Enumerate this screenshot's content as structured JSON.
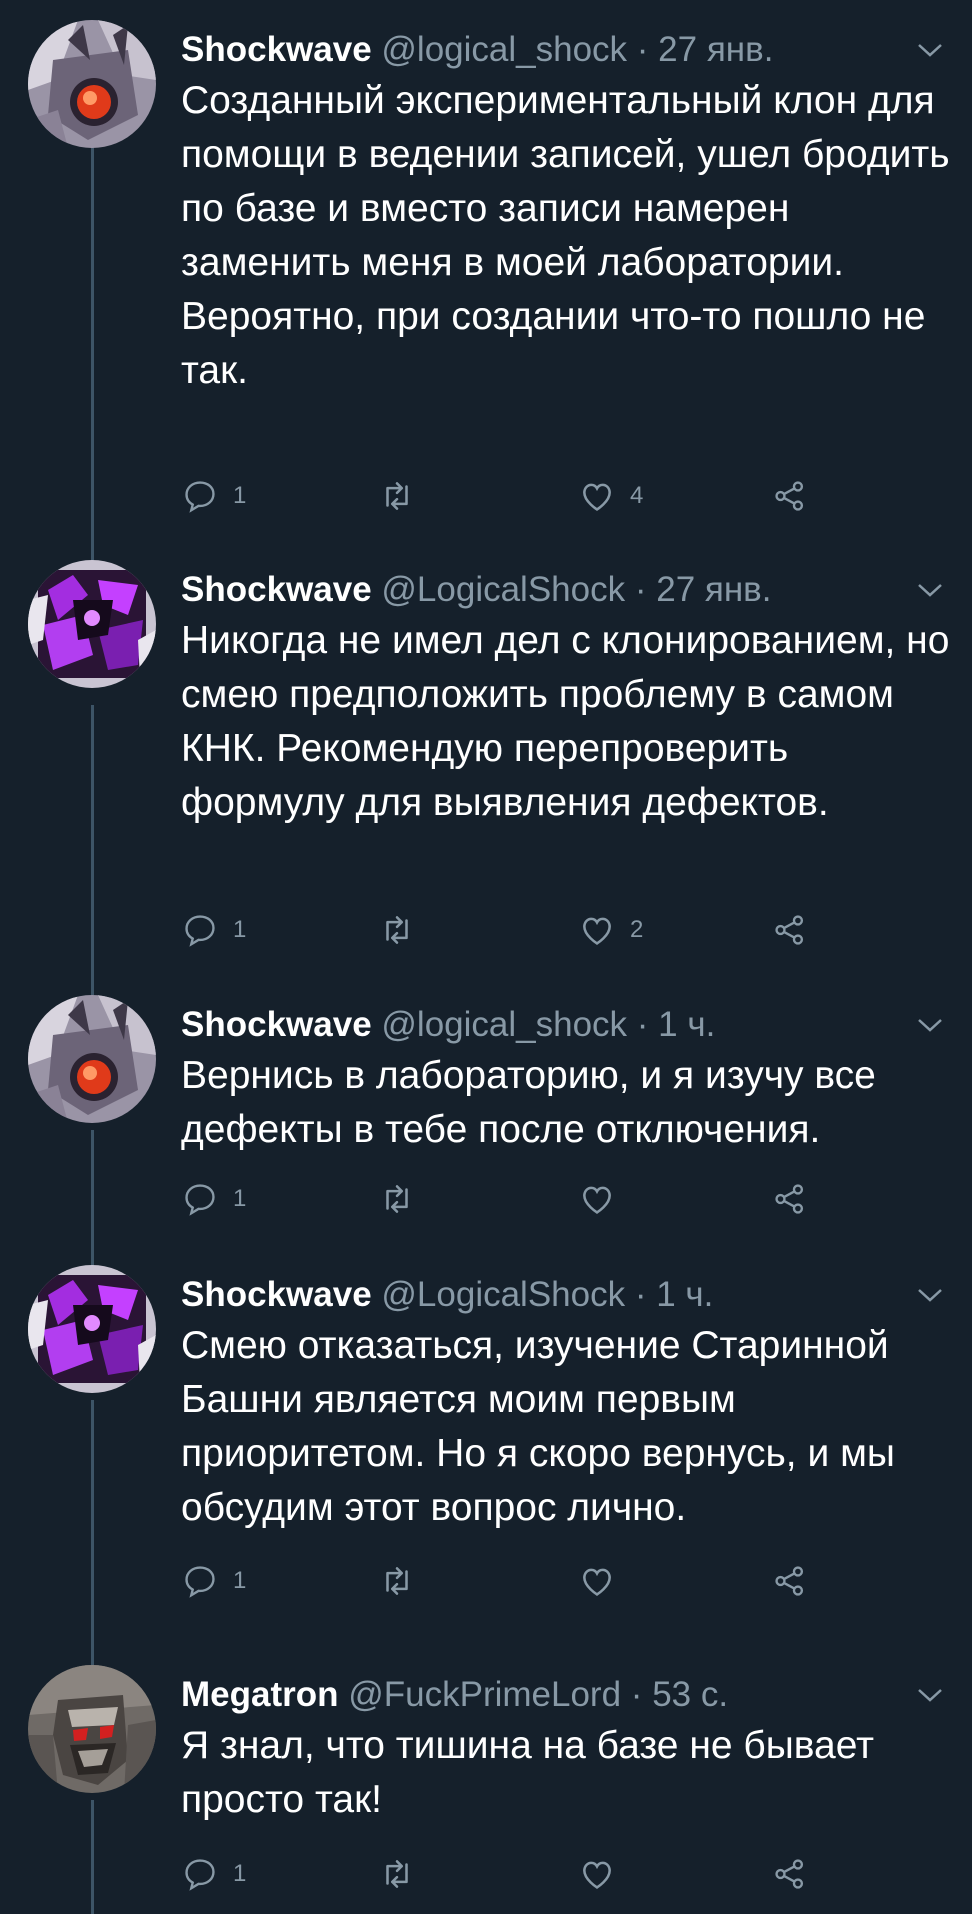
{
  "tweets": [
    {
      "name": "Shockwave",
      "handle": "@logical_shock",
      "dot": "·",
      "time": "27 янв.",
      "text": "Созданный экспериментальный клон для помощи в ведении записей, ушел бродить по базе и вместо записи намерен заменить меня в моей лаборатории.\nВероятно, при создании что-то пошло не так.",
      "reply_count": "1",
      "retweet_count": "",
      "like_count": "4",
      "avatar": "shockwave-grey-avatar"
    },
    {
      "name": "Shockwave",
      "handle": "@LogicalShock",
      "dot": "·",
      "time": "27 янв.",
      "text": "Никогда не имел дел с клонированием, но смею предположить проблему в самом КНК. Рекомендую перепроверить формулу для выявления дефектов.",
      "reply_count": "1",
      "retweet_count": "",
      "like_count": "2",
      "avatar": "shockwave-purple-avatar"
    },
    {
      "name": "Shockwave",
      "handle": "@logical_shock",
      "dot": "·",
      "time": "1 ч.",
      "text": "Вернись в лабораторию, и я изучу все дефекты в тебе после отключения.",
      "reply_count": "1",
      "retweet_count": "",
      "like_count": "",
      "avatar": "shockwave-grey-avatar"
    },
    {
      "name": "Shockwave",
      "handle": "@LogicalShock",
      "dot": "·",
      "time": "1 ч.",
      "text": "Смею отказаться, изучение Старинной Башни является моим первым приоритетом. Но я скоро вернусь, и мы обсудим этот вопрос лично.",
      "reply_count": "1",
      "retweet_count": "",
      "like_count": "",
      "avatar": "shockwave-purple-avatar"
    },
    {
      "name": "Megatron",
      "handle": "@FuckPrimeLord",
      "dot": "·",
      "time": "53 с.",
      "text": "Я знал, что тишина на базе не бывает просто так!",
      "reply_count": "1",
      "retweet_count": "",
      "like_count": "",
      "avatar": "megatron-avatar"
    }
  ],
  "colors": {
    "background": "#15202b",
    "text_primary": "#ffffff",
    "text_secondary": "#8899a6",
    "thread_line": "#3d5466"
  },
  "icons": [
    "reply-icon",
    "retweet-icon",
    "like-icon",
    "share-icon",
    "chevron-down-icon"
  ]
}
